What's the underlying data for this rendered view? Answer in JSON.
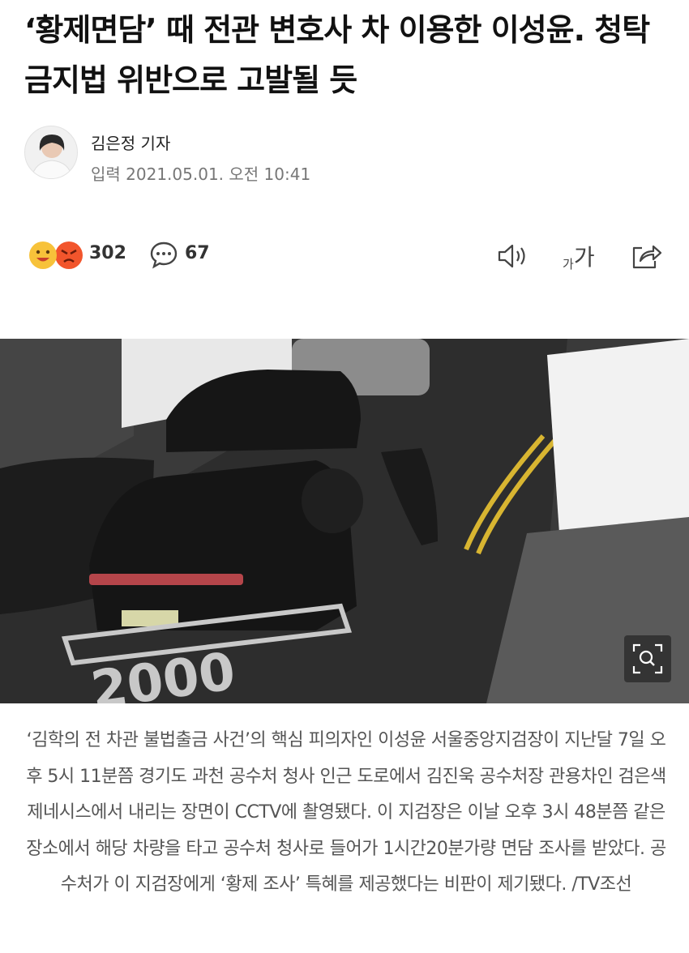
{
  "article": {
    "headline": "‘황제면담’ 때 전관 변호사 차 이용한 이성윤. 청탁금지법 위반으로 고발될 듯",
    "reporter": "김은정 기자",
    "published": "입력 2021.05.01. 오전 10:41",
    "caption": "‘김학의 전 차관 불법출금 사건’의 핵심 피의자인 이성윤 서울중앙지검장이 지난달 7일 오후 5시 11분쯤 경기도 과천 공수처 청사 인근 도로에서 김진욱 공수처장 관용차인 검은색 제네시스에서 내리는 장면이 CCTV에 촬영됐다. 이 지검장은 이날 오후 3시 48분쯤 같은 장소에서 해당 차량을 타고 공수처 청사로 들어가 1시간20분가량 면담 조사를 받았다. 공수처가 이 지검장에게 ‘황제 조사’ 특혜를 제공했다는 비판이 제기됐다. /TV조선"
  },
  "toolbar": {
    "reaction_count": "302",
    "comment_count": "67",
    "font_small": "가",
    "font_large": "가",
    "icons": [
      "smile-emoji-icon",
      "angry-emoji-icon",
      "comment-icon",
      "speaker-icon",
      "font-size-icon",
      "share-icon"
    ]
  },
  "photo": {
    "road_marking": "2000",
    "zoom_icon": "zoom-icon"
  },
  "colors": {
    "emoji_smile": "#f7c23a",
    "emoji_angry": "#f2552c",
    "caption_text": "#555555"
  }
}
